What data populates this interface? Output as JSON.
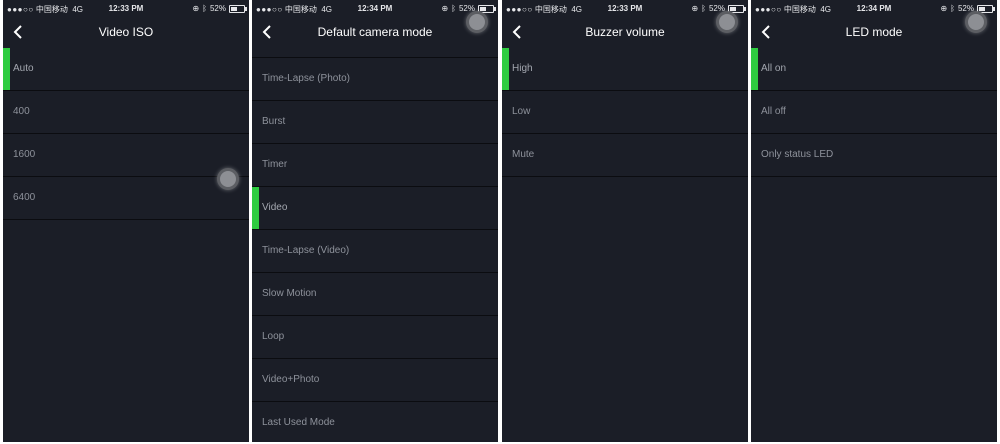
{
  "colors": {
    "panel_bg": "#1b1e27",
    "accent": "#2ecc40",
    "item_text": "#8e929b",
    "title_text": "#ffffff"
  },
  "icons": {
    "back": "chevron-left-icon",
    "assistive_touch": "assistive-touch-button"
  },
  "panels": [
    {
      "status": {
        "carrier": "中国移动",
        "network": "4G",
        "time": "12:33 PM",
        "battery": "52%",
        "battery_level": 0.52
      },
      "title": "Video ISO",
      "items": [
        {
          "label": "Auto",
          "selected": true
        },
        {
          "label": "400",
          "selected": false
        },
        {
          "label": "1600",
          "selected": false
        },
        {
          "label": "6400",
          "selected": false
        }
      ]
    },
    {
      "status": {
        "carrier": "中国移动",
        "network": "4G",
        "time": "12:34 PM",
        "battery": "52%",
        "battery_level": 0.52
      },
      "title": "Default camera mode",
      "items": [
        {
          "label": "Time-Lapse (Photo)",
          "selected": false
        },
        {
          "label": "Burst",
          "selected": false
        },
        {
          "label": "Timer",
          "selected": false
        },
        {
          "label": "Video",
          "selected": true
        },
        {
          "label": "Time-Lapse (Video)",
          "selected": false
        },
        {
          "label": "Slow Motion",
          "selected": false
        },
        {
          "label": "Loop",
          "selected": false
        },
        {
          "label": "Video+Photo",
          "selected": false
        },
        {
          "label": "Last Used Mode",
          "selected": false
        }
      ]
    },
    {
      "status": {
        "carrier": "中国移动",
        "network": "4G",
        "time": "12:33 PM",
        "battery": "52%",
        "battery_level": 0.52
      },
      "title": "Buzzer volume",
      "items": [
        {
          "label": "High",
          "selected": true
        },
        {
          "label": "Low",
          "selected": false
        },
        {
          "label": "Mute",
          "selected": false
        }
      ]
    },
    {
      "status": {
        "carrier": "中国移动",
        "network": "4G",
        "time": "12:34 PM",
        "battery": "52%",
        "battery_level": 0.52
      },
      "title": "LED mode",
      "items": [
        {
          "label": "All on",
          "selected": true
        },
        {
          "label": "All off",
          "selected": false
        },
        {
          "label": "Only status LED",
          "selected": false
        }
      ]
    }
  ]
}
